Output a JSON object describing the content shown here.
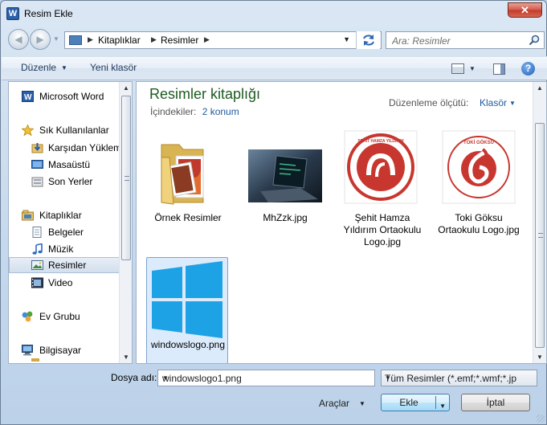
{
  "window": {
    "title": "Resim Ekle",
    "app_icon_letter": "W",
    "close_symbol": "✕"
  },
  "address_bar": {
    "breadcrumbs": [
      "Kitaplıklar",
      "Resimler"
    ],
    "search_placeholder": "Ara: Resimler"
  },
  "toolbar": {
    "organize_label": "Düzenle",
    "new_folder_label": "Yeni klasör",
    "help_symbol": "?"
  },
  "nav_pane": {
    "items": [
      {
        "label": "Microsoft Word",
        "icon": "word-icon"
      },
      {
        "label": "Sık Kullanılanlar",
        "icon": "star-icon"
      },
      {
        "label": "Karşıdan Yüklem",
        "icon": "downloads-icon"
      },
      {
        "label": "Masaüstü",
        "icon": "desktop-icon"
      },
      {
        "label": "Son Yerler",
        "icon": "recent-places-icon"
      },
      {
        "label": "Kitaplıklar",
        "icon": "libraries-icon"
      },
      {
        "label": "Belgeler",
        "icon": "documents-icon"
      },
      {
        "label": "Müzik",
        "icon": "music-icon"
      },
      {
        "label": "Resimler",
        "icon": "pictures-icon"
      },
      {
        "label": "Video",
        "icon": "video-icon"
      },
      {
        "label": "Ev Grubu",
        "icon": "homegroup-icon"
      },
      {
        "label": "Bilgisayar",
        "icon": "computer-icon"
      }
    ]
  },
  "content": {
    "library_title": "Resimler kitaplığı",
    "includes_label": "İçindekiler:",
    "includes_value": "2 konum",
    "arrange_label": "Düzenleme ölçütü:",
    "arrange_value": "Klasör",
    "files": [
      {
        "name": "Örnek Resimler",
        "type": "folder"
      },
      {
        "name": "MhZzk.jpg",
        "type": "image"
      },
      {
        "name": "Şehit Hamza Yıldırım Ortaokulu Logo.jpg",
        "type": "image",
        "logo_text": "ŞEHİT HAMZA YILDIRIM ORTAOKULU"
      },
      {
        "name": "Toki Göksu Ortaokulu Logo.jpg",
        "type": "image",
        "logo_text": "TOKİ GÖKSU ORTAOKULU"
      },
      {
        "name": "windowslogo.png",
        "type": "image"
      }
    ]
  },
  "footer": {
    "filename_label": "Dosya adı:",
    "filename_value": "windowslogo1.png",
    "filetype_value": "Tüm Resimler (*.emf;*.wmf;*.jp",
    "tools_label": "Araçlar",
    "insert_label": "Ekle",
    "cancel_label": "İptal"
  },
  "colors": {
    "library_title": "#1e5a22",
    "link": "#1e5a9e",
    "logo_red": "#c7372f"
  }
}
